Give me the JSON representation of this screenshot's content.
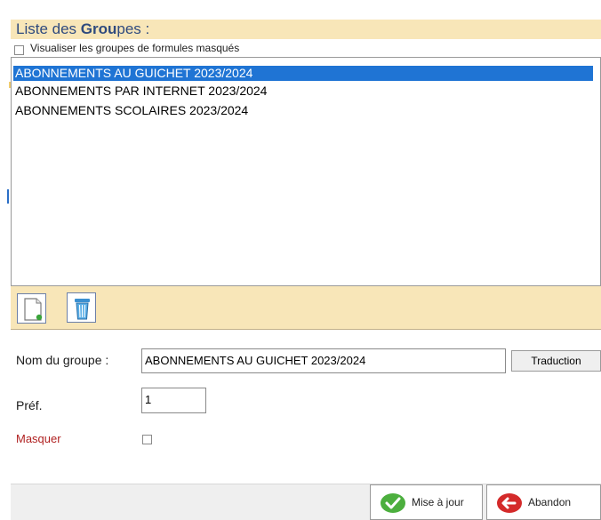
{
  "title": {
    "prefix": "Liste des ",
    "emph": "Grou",
    "suffix": "pes :"
  },
  "show_masked": {
    "label": "Visualiser les groupes de formules masqués",
    "checked": false
  },
  "groups": [
    {
      "label": "ABONNEMENTS AU GUICHET 2023/2024",
      "selected": true
    },
    {
      "label": "ABONNEMENTS PAR INTERNET 2023/2024",
      "selected": false
    },
    {
      "label": "ABONNEMENTS SCOLAIRES 2023/2024",
      "selected": false
    }
  ],
  "toolbar": {
    "new_icon": "new-document-icon",
    "delete_icon": "trash-icon"
  },
  "form": {
    "group_name_label": "Nom du groupe :",
    "group_name_value": "ABONNEMENTS AU GUICHET 2023/2024",
    "translate_label": "Traduction",
    "pref_label": "Préf.",
    "pref_value": "1",
    "mask_label": "Masquer",
    "mask_checked": false
  },
  "buttons": {
    "update_label": "Mise à jour",
    "update_icon": "checkmark-icon",
    "cancel_label": "Abandon",
    "cancel_icon": "back-arrow-icon"
  },
  "colors": {
    "header_band": "#f8e6b8",
    "title_text": "#2f4a7e",
    "selection": "#1f74d4",
    "mask_label": "#b02121"
  }
}
